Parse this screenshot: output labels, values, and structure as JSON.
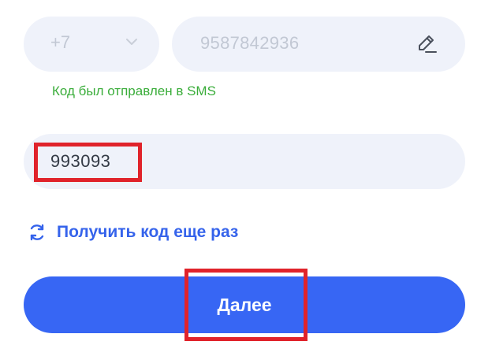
{
  "phone": {
    "country_code": "+7",
    "number": "9587842936"
  },
  "sms_note": "Код был отправлен в SMS",
  "code_input": {
    "value": "993093"
  },
  "resend": {
    "label": "Получить код еще раз"
  },
  "next_button": {
    "label": "Далее"
  },
  "icons": {
    "chevron": "chevron-down-icon",
    "edit": "pencil-icon",
    "resend": "refresh-icon"
  },
  "colors": {
    "field_bg": "#eff2fa",
    "accent": "#3766f4",
    "success": "#3aad3a",
    "highlight": "#e0232b"
  }
}
